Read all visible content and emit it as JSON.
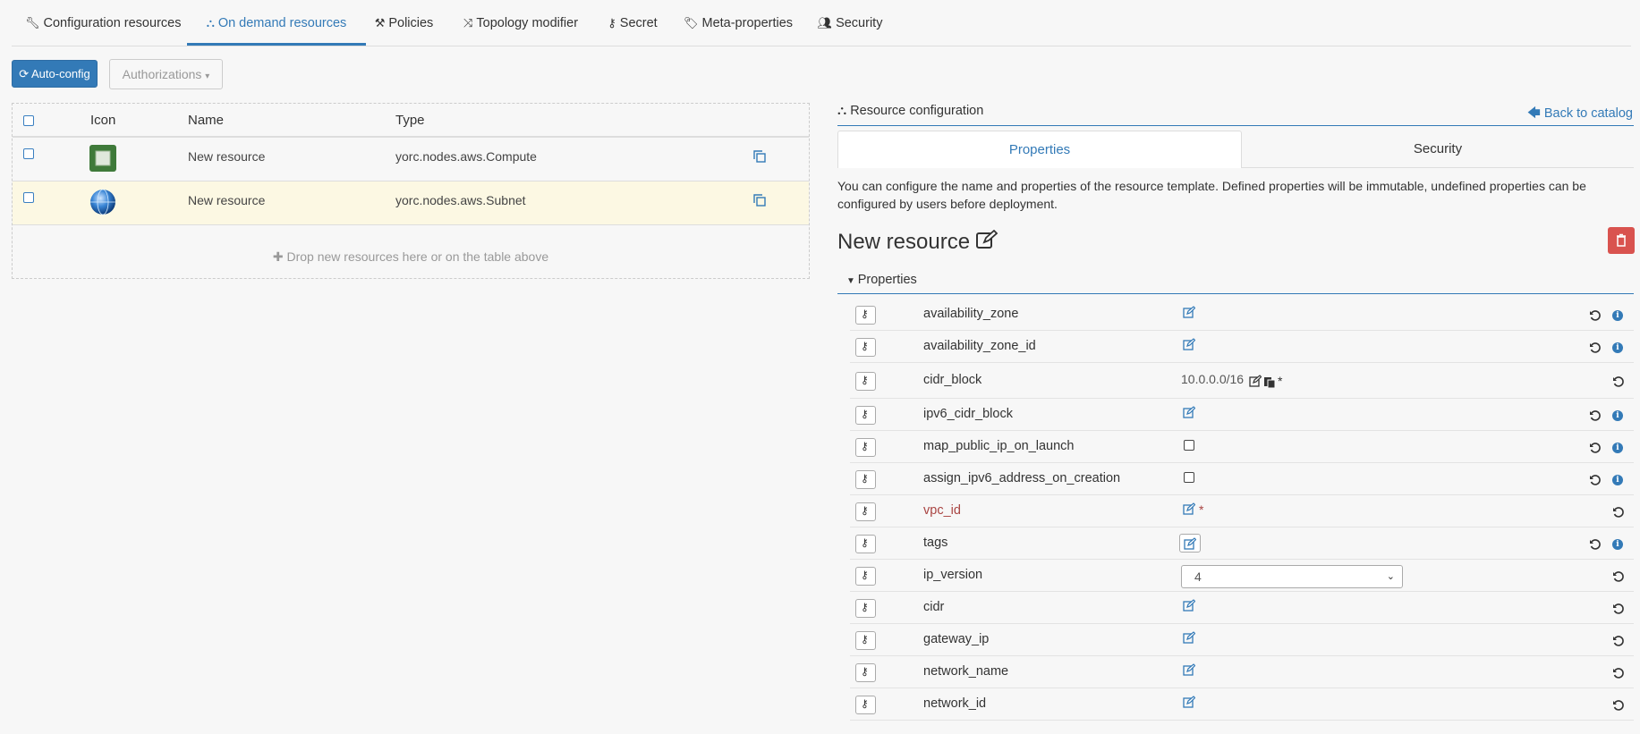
{
  "tabs": [
    {
      "label": "Configuration resources",
      "icon": "wrench-icon"
    },
    {
      "label": "On demand resources",
      "icon": "cubes-icon"
    },
    {
      "label": "Policies",
      "icon": "gavel-icon"
    },
    {
      "label": "Topology modifier",
      "icon": "random-icon"
    },
    {
      "label": "Secret",
      "icon": "key-icon"
    },
    {
      "label": "Meta-properties",
      "icon": "tags-icon"
    },
    {
      "label": "Security",
      "icon": "users-icon"
    }
  ],
  "toolbar": {
    "autoconfig_label": "Auto-config",
    "authorizations_label": "Authorizations"
  },
  "resources_table": {
    "headers": {
      "icon": "Icon",
      "name": "Name",
      "type": "Type"
    },
    "rows": [
      {
        "name": "New resource",
        "type": "yorc.nodes.aws.Compute",
        "icon": "compute-chip-icon"
      },
      {
        "name": "New resource",
        "type": "yorc.nodes.aws.Subnet",
        "icon": "network-globe-icon"
      }
    ],
    "drop_hint": "Drop new resources here or on the table above"
  },
  "panel": {
    "title": "Resource configuration",
    "back_label": "Back to catalog",
    "tabs": {
      "properties": "Properties",
      "security": "Security"
    },
    "description": "You can configure the name and properties of the resource template. Defined properties will be immutable, undefined properties can be configured by users before deployment.",
    "resource_name": "New resource",
    "section_label": "Properties"
  },
  "properties": [
    {
      "name": "availability_zone",
      "value": "",
      "kind": "edit",
      "info": true,
      "required": false
    },
    {
      "name": "availability_zone_id",
      "value": "",
      "kind": "edit",
      "info": true,
      "required": false
    },
    {
      "name": "cidr_block",
      "value": "10.0.0.0/16",
      "kind": "text",
      "info": false,
      "required": true
    },
    {
      "name": "ipv6_cidr_block",
      "value": "",
      "kind": "edit",
      "info": true,
      "required": false
    },
    {
      "name": "map_public_ip_on_launch",
      "value": "",
      "kind": "checkbox",
      "info": true,
      "required": false
    },
    {
      "name": "assign_ipv6_address_on_creation",
      "value": "",
      "kind": "checkbox",
      "info": true,
      "required": false
    },
    {
      "name": "vpc_id",
      "value": "",
      "kind": "edit",
      "info": false,
      "required": true
    },
    {
      "name": "tags",
      "value": "",
      "kind": "editbtn",
      "info": true,
      "required": false
    },
    {
      "name": "ip_version",
      "value": "4",
      "kind": "select",
      "info": false,
      "required": false
    },
    {
      "name": "cidr",
      "value": "",
      "kind": "edit",
      "info": false,
      "required": false
    },
    {
      "name": "gateway_ip",
      "value": "",
      "kind": "edit",
      "info": false,
      "required": false
    },
    {
      "name": "network_name",
      "value": "",
      "kind": "edit",
      "info": false,
      "required": false
    },
    {
      "name": "network_id",
      "value": "",
      "kind": "edit",
      "info": false,
      "required": false
    }
  ],
  "colors": {
    "accent": "#337ab7",
    "danger": "#d9534f",
    "required": "#a94442",
    "selected_row": "#fcf8e3"
  }
}
